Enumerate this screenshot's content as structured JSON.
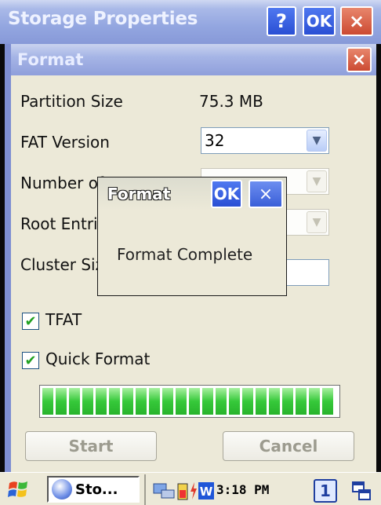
{
  "outer_window": {
    "title": "Storage Properties",
    "help_label": "?",
    "ok_label": "OK",
    "close_label": "×"
  },
  "format_dialog": {
    "title": "Format",
    "close_label": "×",
    "partition_size_label": "Partition Size",
    "partition_size_value": "75.3 MB",
    "fat_version_label": "FAT Version",
    "fat_version_value": "32",
    "number_of_fats_label": "Number of FATs",
    "root_entries_label": "Root Entries",
    "cluster_size_label": "Cluster Size",
    "tfat_label": "TFAT",
    "tfat_checked": true,
    "quick_format_label": "Quick Format",
    "quick_format_checked": true,
    "progress_fraction": 1.0,
    "start_label": "Start",
    "cancel_label": "Cancel"
  },
  "message_box": {
    "title": "Format",
    "ok_label": "OK",
    "close_label": "×",
    "message": "Format Complete"
  },
  "taskbar": {
    "task_label": "Sto...",
    "clock": "3:18 PM",
    "input_indicator": "1",
    "icons": [
      "windows-start-icon",
      "storage-task-icon",
      "network-icon",
      "battery-icon",
      "word-icon",
      "input-panel-icon",
      "windows-switch-icon"
    ]
  },
  "colors": {
    "title_blue": "#8f9fdb",
    "ok_button_blue": "#2a4fd4",
    "close_button_red": "#cc4a32",
    "progress_green": "#36c93a",
    "dialog_background": "#ece9d8"
  }
}
